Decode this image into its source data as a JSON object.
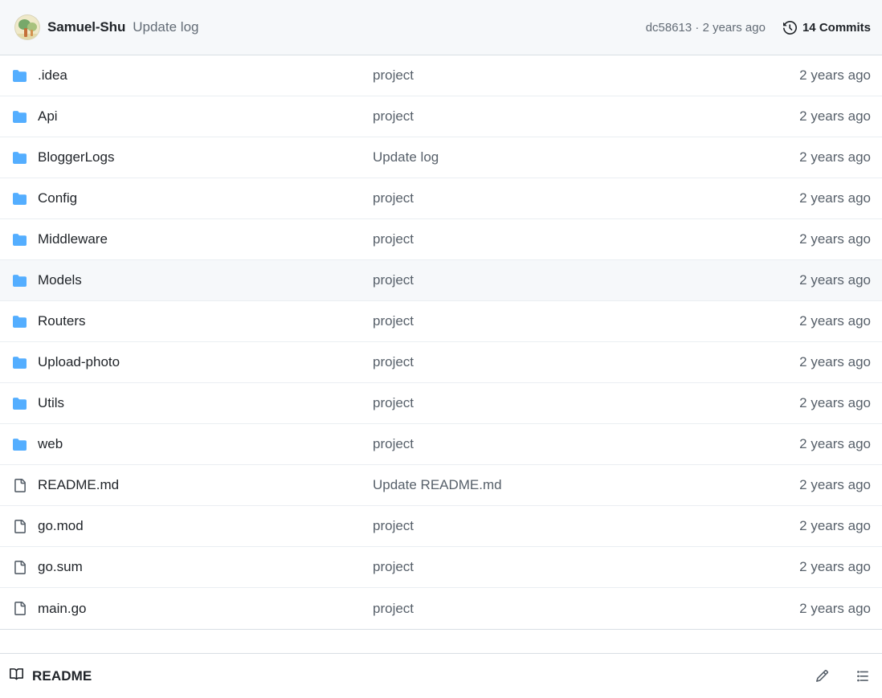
{
  "commit_header": {
    "avatar_name": "user-avatar-tree",
    "author": "Samuel-Shu",
    "message": "Update log",
    "sha_and_time": "dc58613 · 2 years ago",
    "commits_label": "14 Commits",
    "history_icon": "history-icon"
  },
  "file_list": {
    "rows": [
      {
        "icon": "folder-icon",
        "type": "folder",
        "name": ".idea",
        "commit": "project",
        "age": "2 years ago",
        "active": false
      },
      {
        "icon": "folder-icon",
        "type": "folder",
        "name": "Api",
        "commit": "project",
        "age": "2 years ago",
        "active": false
      },
      {
        "icon": "folder-icon",
        "type": "folder",
        "name": "BloggerLogs",
        "commit": "Update log",
        "age": "2 years ago",
        "active": false
      },
      {
        "icon": "folder-icon",
        "type": "folder",
        "name": "Config",
        "commit": "project",
        "age": "2 years ago",
        "active": false
      },
      {
        "icon": "folder-icon",
        "type": "folder",
        "name": "Middleware",
        "commit": "project",
        "age": "2 years ago",
        "active": false
      },
      {
        "icon": "folder-icon",
        "type": "folder",
        "name": "Models",
        "commit": "project",
        "age": "2 years ago",
        "active": true
      },
      {
        "icon": "folder-icon",
        "type": "folder",
        "name": "Routers",
        "commit": "project",
        "age": "2 years ago",
        "active": false
      },
      {
        "icon": "folder-icon",
        "type": "folder",
        "name": "Upload-photo",
        "commit": "project",
        "age": "2 years ago",
        "active": false
      },
      {
        "icon": "folder-icon",
        "type": "folder",
        "name": "Utils",
        "commit": "project",
        "age": "2 years ago",
        "active": false
      },
      {
        "icon": "folder-icon",
        "type": "folder",
        "name": "web",
        "commit": "project",
        "age": "2 years ago",
        "active": false
      },
      {
        "icon": "file-icon",
        "type": "file",
        "name": "README.md",
        "commit": "Update README.md",
        "age": "2 years ago",
        "active": false
      },
      {
        "icon": "file-icon",
        "type": "file",
        "name": "go.mod",
        "commit": "project",
        "age": "2 years ago",
        "active": false
      },
      {
        "icon": "file-icon",
        "type": "file",
        "name": "go.sum",
        "commit": "project",
        "age": "2 years ago",
        "active": false
      },
      {
        "icon": "file-icon",
        "type": "file",
        "name": "main.go",
        "commit": "project",
        "age": "2 years ago",
        "active": false
      }
    ]
  },
  "readme_section": {
    "book_icon": "book-icon",
    "title": "README",
    "edit_icon": "pencil-icon",
    "outline_icon": "list-unordered-icon"
  },
  "colors": {
    "folder_blue": "#54aeff",
    "header_bg": "#f6f8fa",
    "row_hover_bg": "#f6f8fa",
    "border": "#d8dee4",
    "row_border": "#eaeef2",
    "text_primary": "#1f2328",
    "text_muted": "#57606a"
  }
}
